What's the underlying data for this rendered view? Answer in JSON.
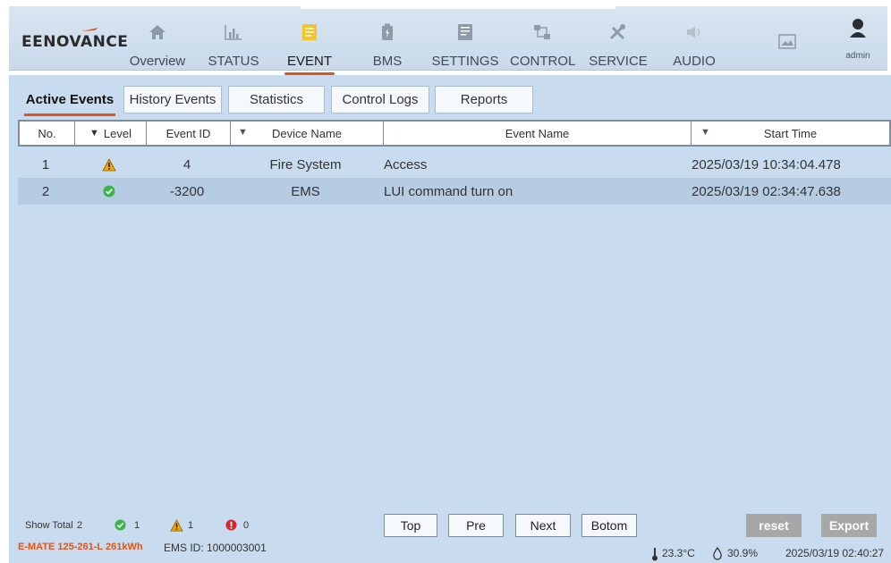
{
  "app": {
    "logo_text": "EENOVANCE"
  },
  "nav": {
    "items": [
      {
        "label": "Overview"
      },
      {
        "label": "STATUS"
      },
      {
        "label": "EVENT"
      },
      {
        "label": "BMS"
      },
      {
        "label": "SETTINGS"
      },
      {
        "label": "CONTROL"
      },
      {
        "label": "SERVICE"
      },
      {
        "label": "AUDIO"
      }
    ],
    "active": "EVENT",
    "user": "admin"
  },
  "subtabs": [
    {
      "label": "Active Events"
    },
    {
      "label": "History Events"
    },
    {
      "label": "Statistics"
    },
    {
      "label": "Control Logs"
    },
    {
      "label": "Reports"
    }
  ],
  "table": {
    "headers": {
      "no": "No.",
      "level": "Level",
      "event_id": "Event ID",
      "device_name": "Device Name",
      "event_name": "Event Name",
      "start_time": "Start Time"
    },
    "rows": [
      {
        "no": "1",
        "level": "warning",
        "event_id": "4",
        "device_name": "Fire System",
        "event_name": "Access",
        "start_time": "2025/03/19 10:34:04.478"
      },
      {
        "no": "2",
        "level": "ok",
        "event_id": "-3200",
        "device_name": "EMS",
        "event_name": "LUI command turn on",
        "start_time": "2025/03/19 02:34:47.638"
      }
    ]
  },
  "footer": {
    "show_total_label": "Show Total",
    "show_total": "2",
    "ok_count": "1",
    "warning_count": "1",
    "error_count": "0",
    "pager": {
      "top": "Top",
      "pre": "Pre",
      "next": "Next",
      "bottom": "Botom"
    },
    "reset": "reset",
    "export": "Export",
    "model": "E-MATE 125-261-L 261kWh",
    "ems_id": "EMS ID: 1000003001",
    "temperature": "23.3°C",
    "humidity": "30.9%",
    "datetime": "2025/03/19 02:40:27"
  },
  "colors": {
    "accent": "#e0541b",
    "warning": "#f0a500",
    "ok": "#3bb54a",
    "error": "#d9262c"
  }
}
